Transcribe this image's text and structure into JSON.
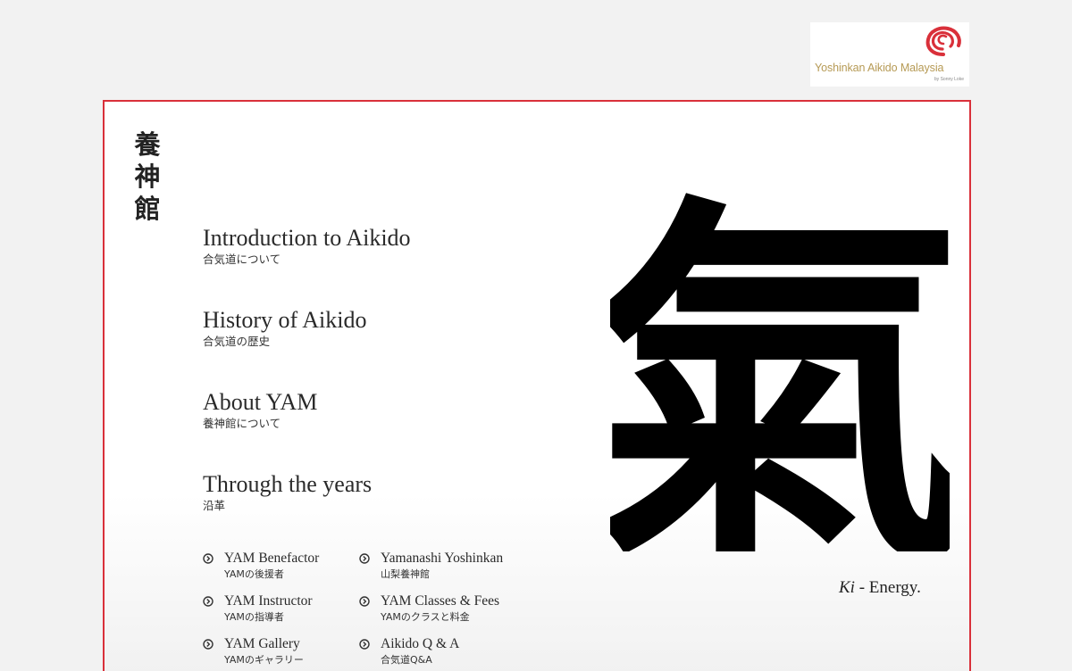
{
  "logo": {
    "title": "Yoshinkan Aikido Malaysia",
    "byline": "by Sonny Loke",
    "accent": "#d9303a",
    "text_color": "#b69a55"
  },
  "sidebar": {
    "kanji": [
      "養",
      "神",
      "館"
    ]
  },
  "menu": [
    {
      "en": "Introduction to Aikido",
      "jp": "合気道について"
    },
    {
      "en": "History of Aikido",
      "jp": "合気道の歴史"
    },
    {
      "en": "About YAM",
      "jp": "養神館について"
    },
    {
      "en": "Through the years",
      "jp": "沿革"
    }
  ],
  "submenu": [
    {
      "en": "YAM Benefactor",
      "jp": "YAMの後援者",
      "icon": "circle-chevron-right-icon"
    },
    {
      "en": "Yamanashi Yoshinkan",
      "jp": "山梨養神館",
      "icon": "circle-chevron-right-icon"
    },
    {
      "en": "YAM Instructor",
      "jp": "YAMの指導者",
      "icon": "circle-chevron-right-icon"
    },
    {
      "en": "YAM Classes & Fees",
      "jp": "YAMのクラスと料金",
      "icon": "circle-chevron-right-icon"
    },
    {
      "en": "YAM Gallery",
      "jp": "YAMのギャラリー",
      "icon": "circle-chevron-right-icon"
    },
    {
      "en": "Aikido Q & A",
      "jp": "合気道Q&A",
      "icon": "circle-chevron-right-icon"
    }
  ],
  "feature": {
    "glyph": "氣",
    "caption_term": "Ki",
    "caption_rest": " - Energy."
  },
  "colors": {
    "background": "#f2f2f2",
    "frame_border": "#d9303a",
    "text": "#2a2a2a"
  }
}
